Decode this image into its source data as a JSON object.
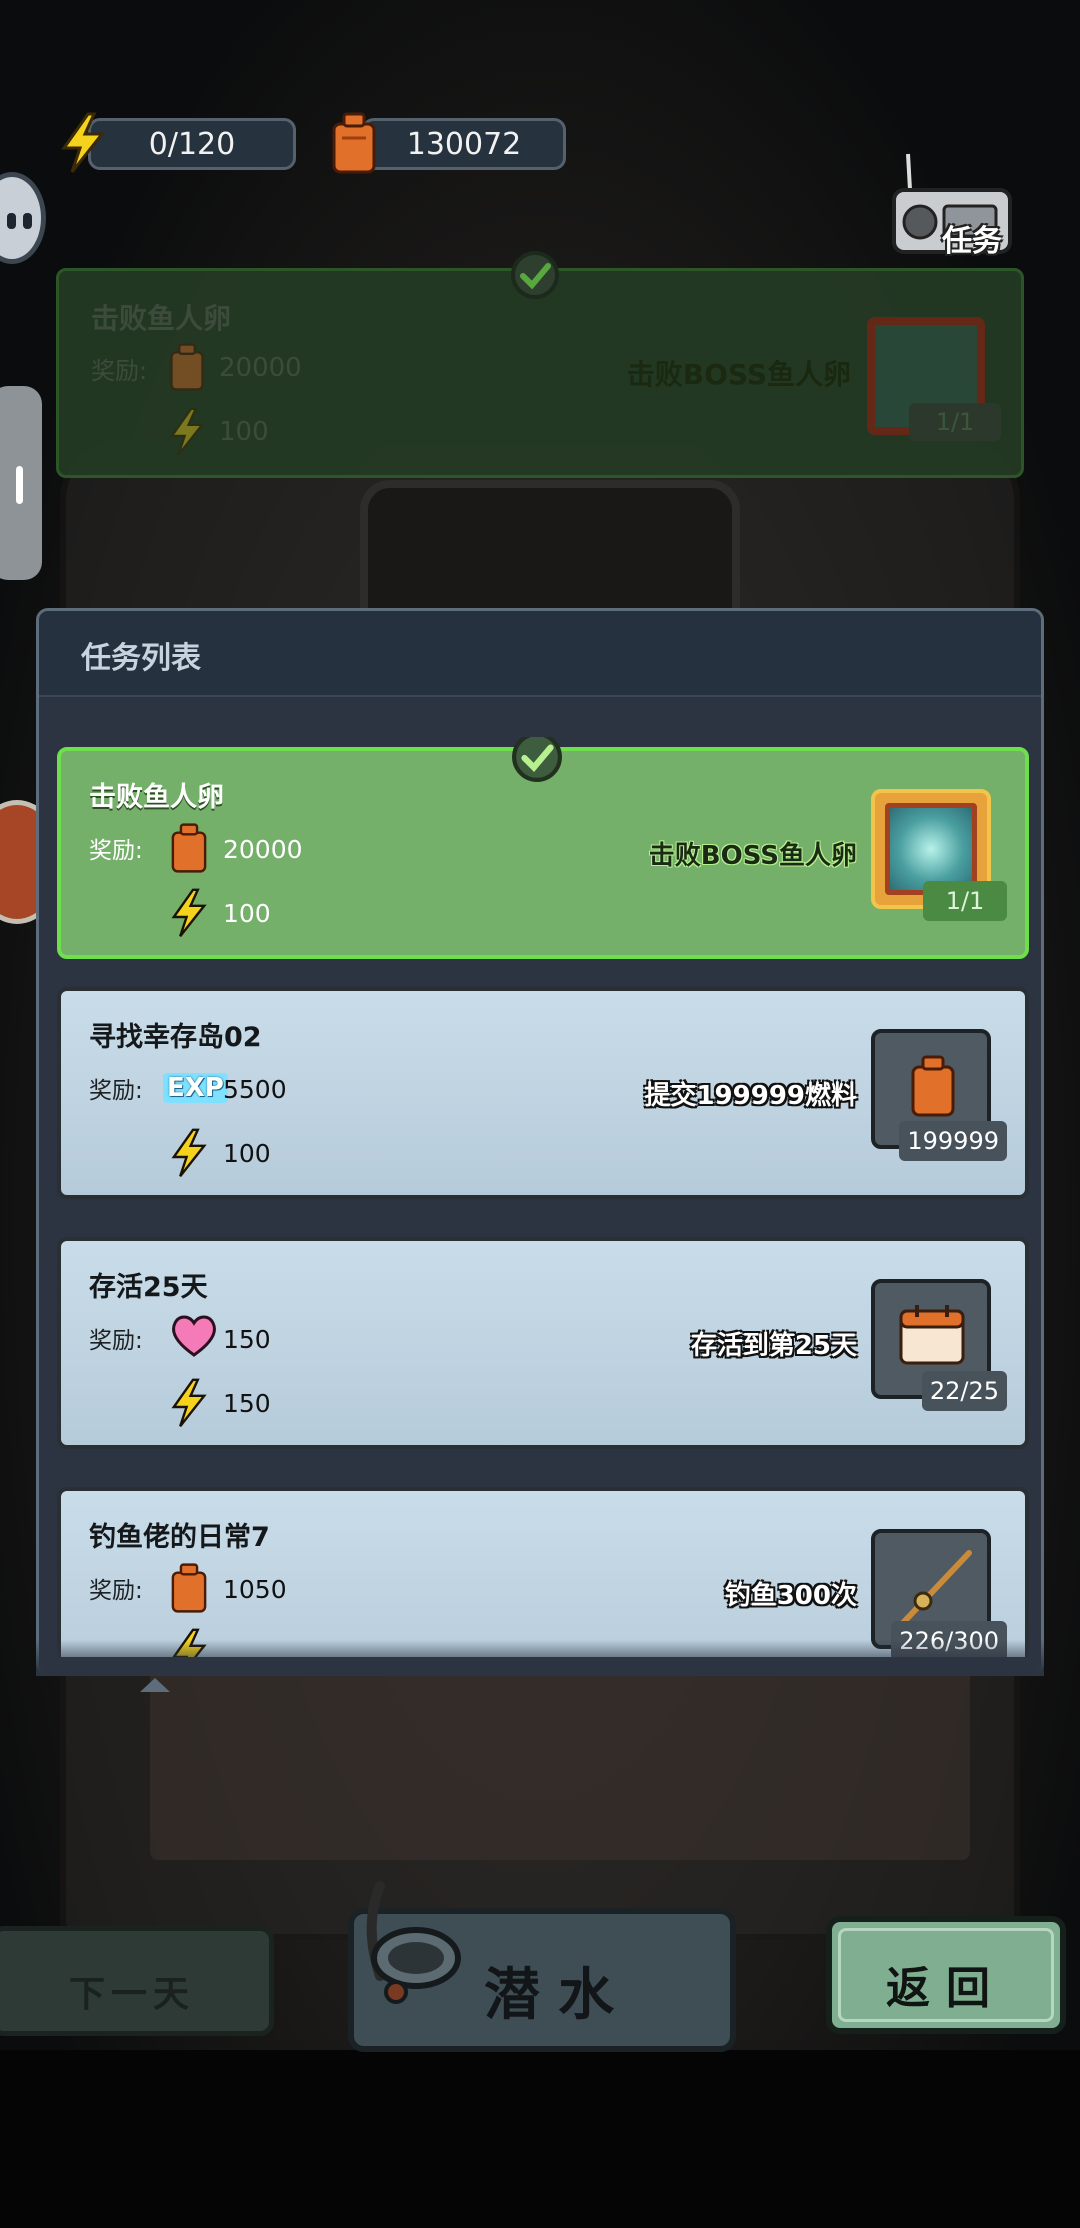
{
  "resources": {
    "energy": "0/120",
    "fuel": "130072"
  },
  "radio": {
    "label": "任务"
  },
  "active_banner": {
    "title": "击败鱼人卵",
    "reward_label": "奖励:",
    "reward_fuel": "20000",
    "reward_energy": "100",
    "goal": "击败BOSS鱼人卵",
    "progress": "1/1"
  },
  "panel": {
    "title": "任务列表",
    "tasks": [
      {
        "title": "击败鱼人卵",
        "reward_label": "奖励:",
        "reward1_icon": "fuel-can-icon",
        "reward1": "20000",
        "reward2_icon": "lightning-icon",
        "reward2": "100",
        "goal": "击败BOSS鱼人卵",
        "progress": "1/1",
        "thumb_icon": "fish-egg-icon",
        "completed": true
      },
      {
        "title": "寻找幸存岛02",
        "reward_label": "奖励:",
        "reward1_icon": "exp-icon",
        "reward1_icon_text": "EXP",
        "reward1": "5500",
        "reward2_icon": "lightning-icon",
        "reward2": "100",
        "goal": "提交199999燃料",
        "progress": "199999",
        "thumb_icon": "fuel-can-icon",
        "completed": false
      },
      {
        "title": "存活25天",
        "reward_label": "奖励:",
        "reward1_icon": "heart-icon",
        "reward1": "150",
        "reward2_icon": "lightning-icon",
        "reward2": "150",
        "goal": "存活到第25天",
        "progress": "22/25",
        "thumb_icon": "calendar-icon",
        "completed": false
      },
      {
        "title": "钓鱼佬的日常7",
        "reward_label": "奖励:",
        "reward1_icon": "fuel-can-icon",
        "reward1": "1050",
        "reward2_icon": "lightning-icon",
        "reward2": "",
        "goal": "钓鱼300次",
        "progress": "226/300",
        "thumb_icon": "fishing-rod-icon",
        "completed": false
      }
    ]
  },
  "buttons": {
    "next_day": "下一天",
    "dive": "潜水",
    "back": "返回"
  },
  "colors": {
    "completed_card": "#74b06a",
    "completed_border": "#6ee04c",
    "todo_card": "#c9dce9",
    "panel_bg": "#2b3440",
    "energy": "#f5d21c",
    "fuel": "#e0702a"
  }
}
